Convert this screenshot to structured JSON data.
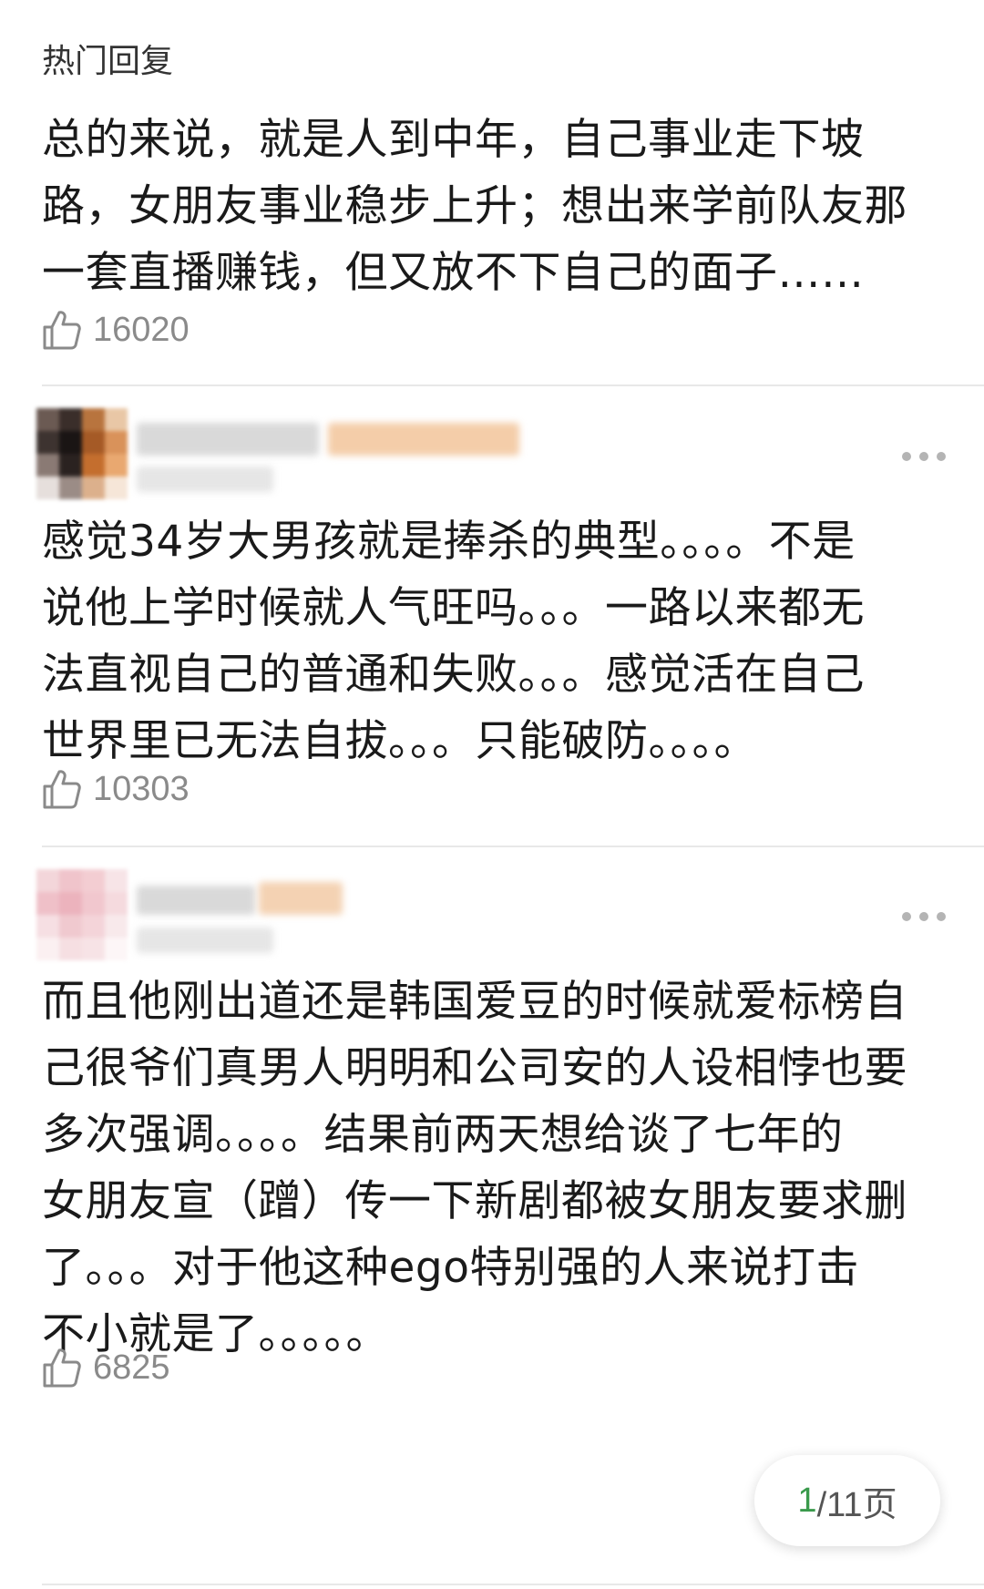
{
  "header": {
    "title": "热门回复"
  },
  "comments": [
    {
      "text": "总的来说，就是人到中年，自己事业走下坡\n路，女朋友事业稳步上升；想出来学前队友那\n一套直播赚钱，但又放不下自己的面子……",
      "likes": "16020"
    },
    {
      "text": "感觉34岁大男孩就是捧杀的典型。。。。不是\n说他上学时候就人气旺吗。。。一路以来都无\n法直视自己的普通和失败。。。感觉活在自己\n世界里已无法自拔。。。只能破防。。。。",
      "likes": "10303"
    },
    {
      "text": "而且他刚出道还是韩国爱豆的时候就爱标榜自\n己很爷们真男人明明和公司安的人设相悖也要\n多次强调。。。。结果前两天想给谈了七年的\n女朋友宣（蹭）传一下新剧都被女朋友要求删\n了。。。对于他这种ego特别强的人来说打击\n不小就是了。。。。。",
      "likes": "6825"
    }
  ],
  "pager": {
    "current": "1",
    "rest": "/11页"
  },
  "icons": {
    "like": "thumbs-up-icon",
    "more": "more-dots-icon"
  }
}
